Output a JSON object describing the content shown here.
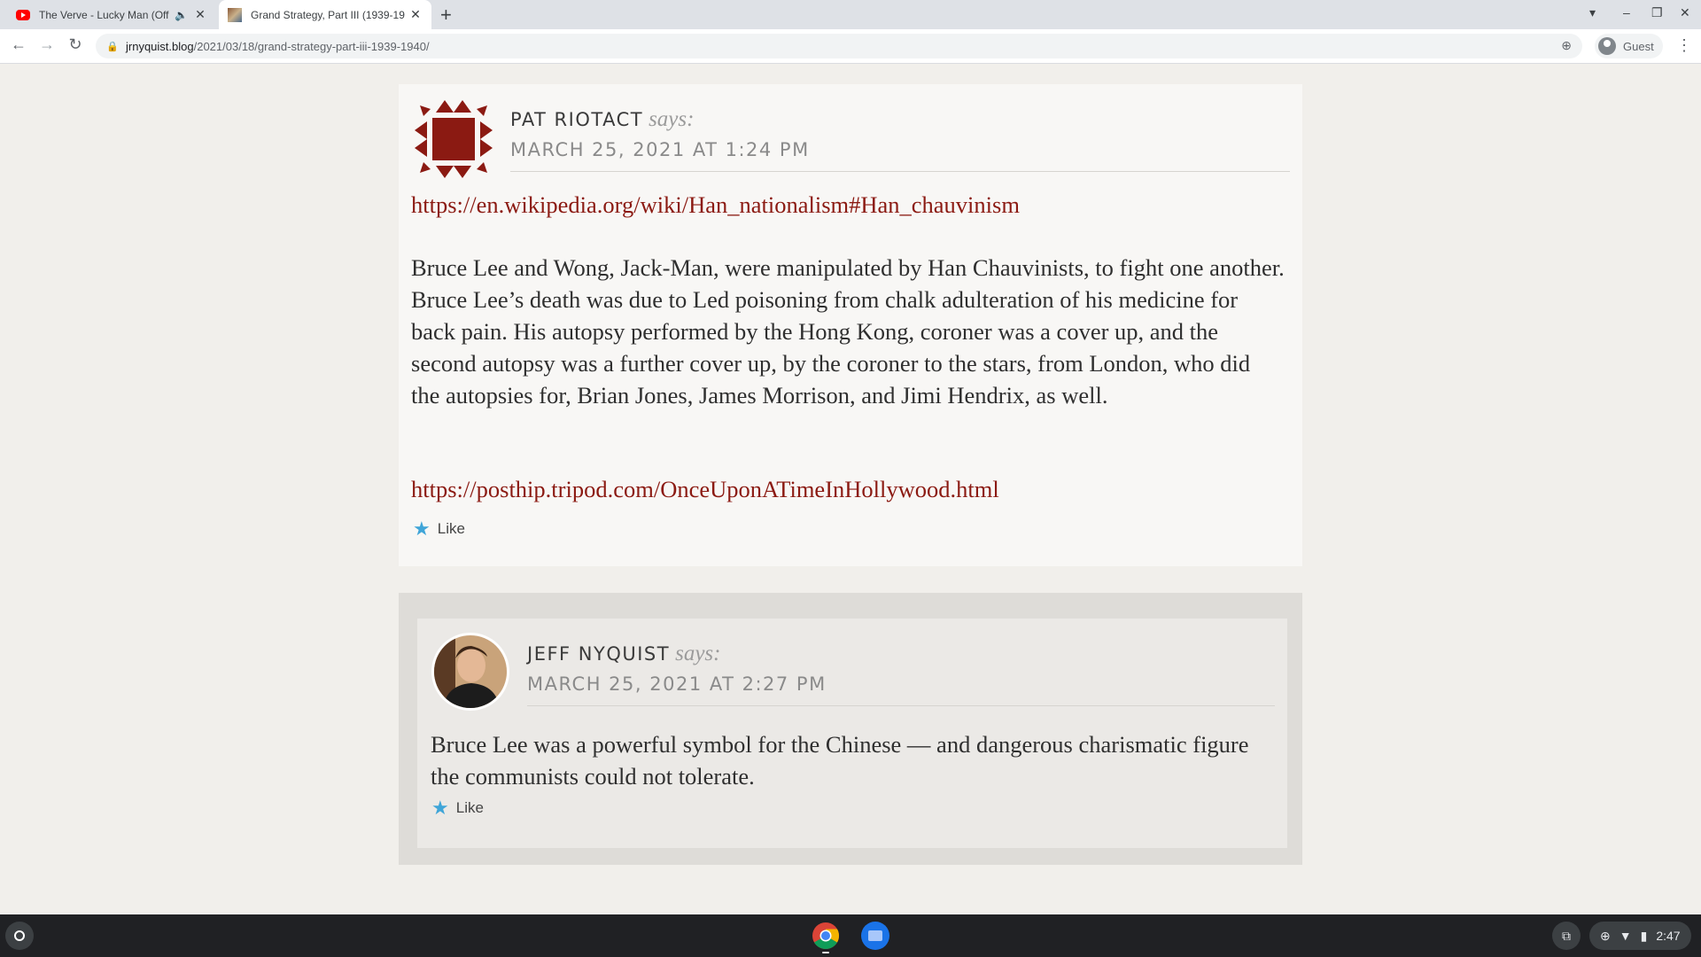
{
  "browser": {
    "tabs": [
      {
        "title": "The Verve - Lucky Man (Offic",
        "icon": "youtube-icon",
        "audio": true,
        "active": false
      },
      {
        "title": "Grand Strategy, Part III (1939-19",
        "icon": "site-favicon",
        "active": true
      }
    ],
    "url_domain": "jrnyquist.blog",
    "url_path": "/2021/03/18/grand-strategy-part-iii-1939-1940/",
    "profile_label": "Guest"
  },
  "comments": [
    {
      "author": "PAT RIOTACT",
      "says": "says:",
      "date": "MARCH 25, 2021 AT 1:24 PM",
      "link1": "https://en.wikipedia.org/wiki/Han_nationalism#Han_chauvinism",
      "paragraph": "Bruce Lee and Wong, Jack-Man, were manipulated by Han Chauvinists, to fight one another. Bruce Lee’s death was due to Led poisoning from chalk adulteration of his medicine for back pain. His autopsy performed by the Hong Kong, coroner was a cover up, and the second autopsy was a further cover up, by the coroner to the stars, from London, who did the autopsies for, Brian Jones, James Morrison, and Jimi Hendrix, as well.",
      "link2": "https://posthip.tripod.com/OnceUponATimeInHollywood.html",
      "like_label": "Like"
    },
    {
      "author": "JEFF NYQUIST",
      "says": "says:",
      "date": "MARCH 25, 2021 AT 2:27 PM",
      "paragraph": "Bruce Lee was a powerful symbol for the Chinese — and dangerous charismatic figure the communists could not tolerate.",
      "like_label": "Like"
    }
  ],
  "shelf": {
    "time": "2:47"
  },
  "colors": {
    "link": "#8b1a12",
    "star": "#3fa5d8",
    "page_bg": "#f1efeb"
  }
}
